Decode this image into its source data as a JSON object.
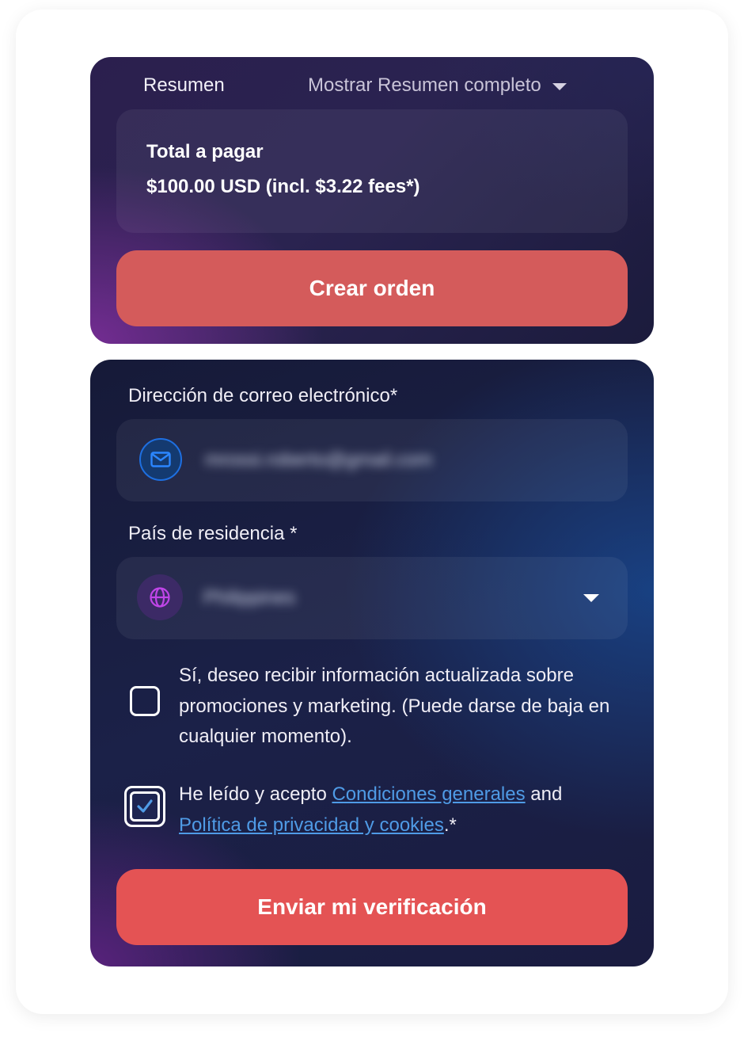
{
  "summary": {
    "label": "Resumen",
    "toggle_label": "Mostrar Resumen completo",
    "total_title": "Total a pagar",
    "total_amount": "$100.00 USD (incl. $3.22 fees*)",
    "create_button": "Crear orden"
  },
  "form": {
    "email_label": "Dirección de correo electrónico*",
    "email_value": "mrossi.roberto@gmail.com",
    "country_label": "País de residencia *",
    "country_value": "Philippines",
    "marketing": {
      "checked": false,
      "text": "Sí, deseo recibir información actualizada sobre promociones y marketing. (Puede darse de baja en cualquier momento)."
    },
    "terms": {
      "checked": true,
      "prefix": "He leído y acepto ",
      "link1": "Condiciones generales",
      "middle": " and",
      "link2": "Política de privacidad y cookies",
      "suffix": ".*"
    },
    "submit_button": "Enviar mi verificación"
  },
  "icons": {
    "email": "mail-icon",
    "country": "globe-icon",
    "dropdown": "caret-down-icon",
    "checkmark": "check-icon"
  },
  "colors": {
    "primary_button": "#e45354",
    "secondary_button": "#d45b5b",
    "link": "#4f9be6",
    "mail_icon_accent": "#1e6fe0",
    "globe_icon_accent": "#c045e8"
  }
}
